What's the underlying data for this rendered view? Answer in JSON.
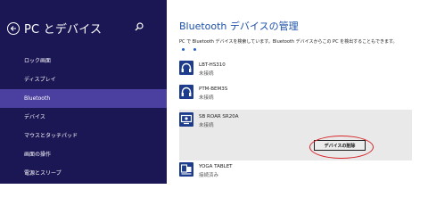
{
  "sidebar": {
    "title": "PC とデバイス",
    "items": [
      {
        "label": "ロック画面"
      },
      {
        "label": "ディスプレイ"
      },
      {
        "label": "Bluetooth"
      },
      {
        "label": "デバイス"
      },
      {
        "label": "マウスとタッチパッド"
      },
      {
        "label": "画面の操作"
      },
      {
        "label": "電源とスリープ"
      }
    ]
  },
  "main": {
    "title": "Bluetooth デバイスの管理",
    "description": "PC で Bluetooth デバイスを検索しています。Bluetooth デバイスからこの PC を検出することもできます。",
    "devices": [
      {
        "name": "LBT-HS310",
        "status": "未接続",
        "icon": "headphones-icon"
      },
      {
        "name": "PTM-BEM3S",
        "status": "未接続",
        "icon": "headphones-icon"
      },
      {
        "name": "SB ROAR SR20A",
        "status": "未接続",
        "icon": "speaker-icon"
      },
      {
        "name": "YOGA TABLET",
        "status": "接続済み",
        "icon": "tablet-icon"
      }
    ],
    "remove_label": "デバイスの削除"
  },
  "colors": {
    "sidebar_bg": "#1b1654",
    "active_item": "#4b3fa0",
    "title_blue": "#1c4fa8",
    "highlight_red": "#d8262a"
  }
}
